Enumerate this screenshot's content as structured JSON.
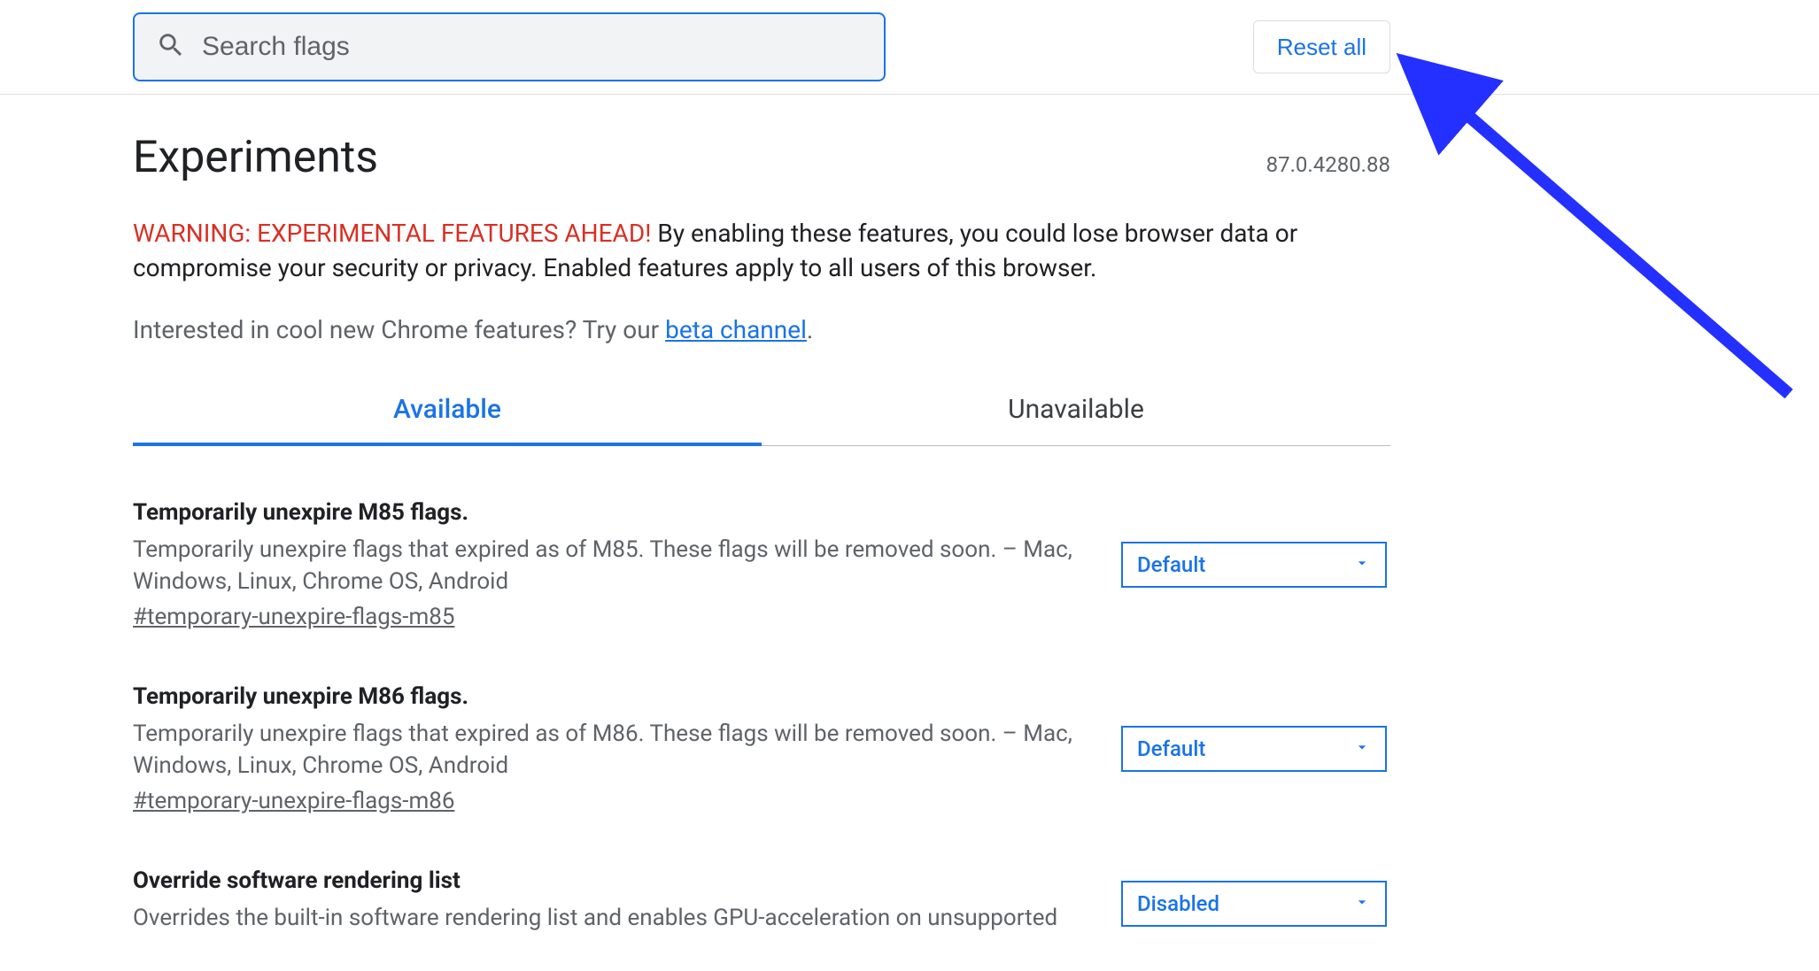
{
  "search": {
    "placeholder": "Search flags"
  },
  "reset_button": "Reset all",
  "header": {
    "title": "Experiments",
    "version": "87.0.4280.88"
  },
  "warning": {
    "red": "WARNING: EXPERIMENTAL FEATURES AHEAD!",
    "rest": " By enabling these features, you could lose browser data or compromise your security or privacy. Enabled features apply to all users of this browser."
  },
  "beta": {
    "prefix": "Interested in cool new Chrome features? Try our ",
    "link": "beta channel",
    "suffix": "."
  },
  "tabs": {
    "available": "Available",
    "unavailable": "Unavailable"
  },
  "flags": [
    {
      "title": "Temporarily unexpire M85 flags.",
      "desc": "Temporarily unexpire flags that expired as of M85. These flags will be removed soon. – Mac, Windows, Linux, Chrome OS, Android",
      "anchor": "#temporary-unexpire-flags-m85",
      "value": "Default"
    },
    {
      "title": "Temporarily unexpire M86 flags.",
      "desc": "Temporarily unexpire flags that expired as of M86. These flags will be removed soon. – Mac, Windows, Linux, Chrome OS, Android",
      "anchor": "#temporary-unexpire-flags-m86",
      "value": "Default"
    },
    {
      "title": "Override software rendering list",
      "desc": "Overrides the built-in software rendering list and enables GPU-acceleration on unsupported",
      "anchor": "",
      "value": "Disabled"
    }
  ]
}
